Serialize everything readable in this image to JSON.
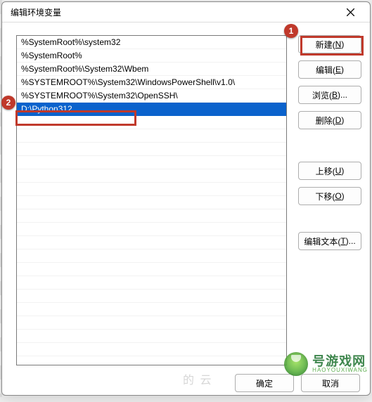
{
  "window": {
    "title": "编辑环境变量"
  },
  "list": {
    "items": [
      "%SystemRoot%\\system32",
      "%SystemRoot%",
      "%SystemRoot%\\System32\\Wbem",
      "%SYSTEMROOT%\\System32\\WindowsPowerShell\\v1.0\\",
      "%SYSTEMROOT%\\System32\\OpenSSH\\",
      "D:\\Python312"
    ],
    "selected_index": 5
  },
  "buttons": {
    "new": {
      "text": "新建(",
      "hotkey": "N",
      "suffix": ")"
    },
    "edit": {
      "text": "编辑(",
      "hotkey": "E",
      "suffix": ")"
    },
    "browse": {
      "text": "浏览(",
      "hotkey": "B",
      "suffix": ")..."
    },
    "delete": {
      "text": "删除(",
      "hotkey": "D",
      "suffix": ")"
    },
    "moveup": {
      "text": "上移(",
      "hotkey": "U",
      "suffix": ")"
    },
    "movedown": {
      "text": "下移(",
      "hotkey": "O",
      "suffix": ")"
    },
    "edittext": {
      "text": "编辑文本(",
      "hotkey": "T",
      "suffix": ")..."
    },
    "ok": "确定",
    "cancel": "取消"
  },
  "callouts": {
    "c1": "1",
    "c2": "2"
  },
  "watermark": {
    "line1": "号游戏网",
    "line2": "HAOYOUXIWANG"
  },
  "ghost": "的 云"
}
